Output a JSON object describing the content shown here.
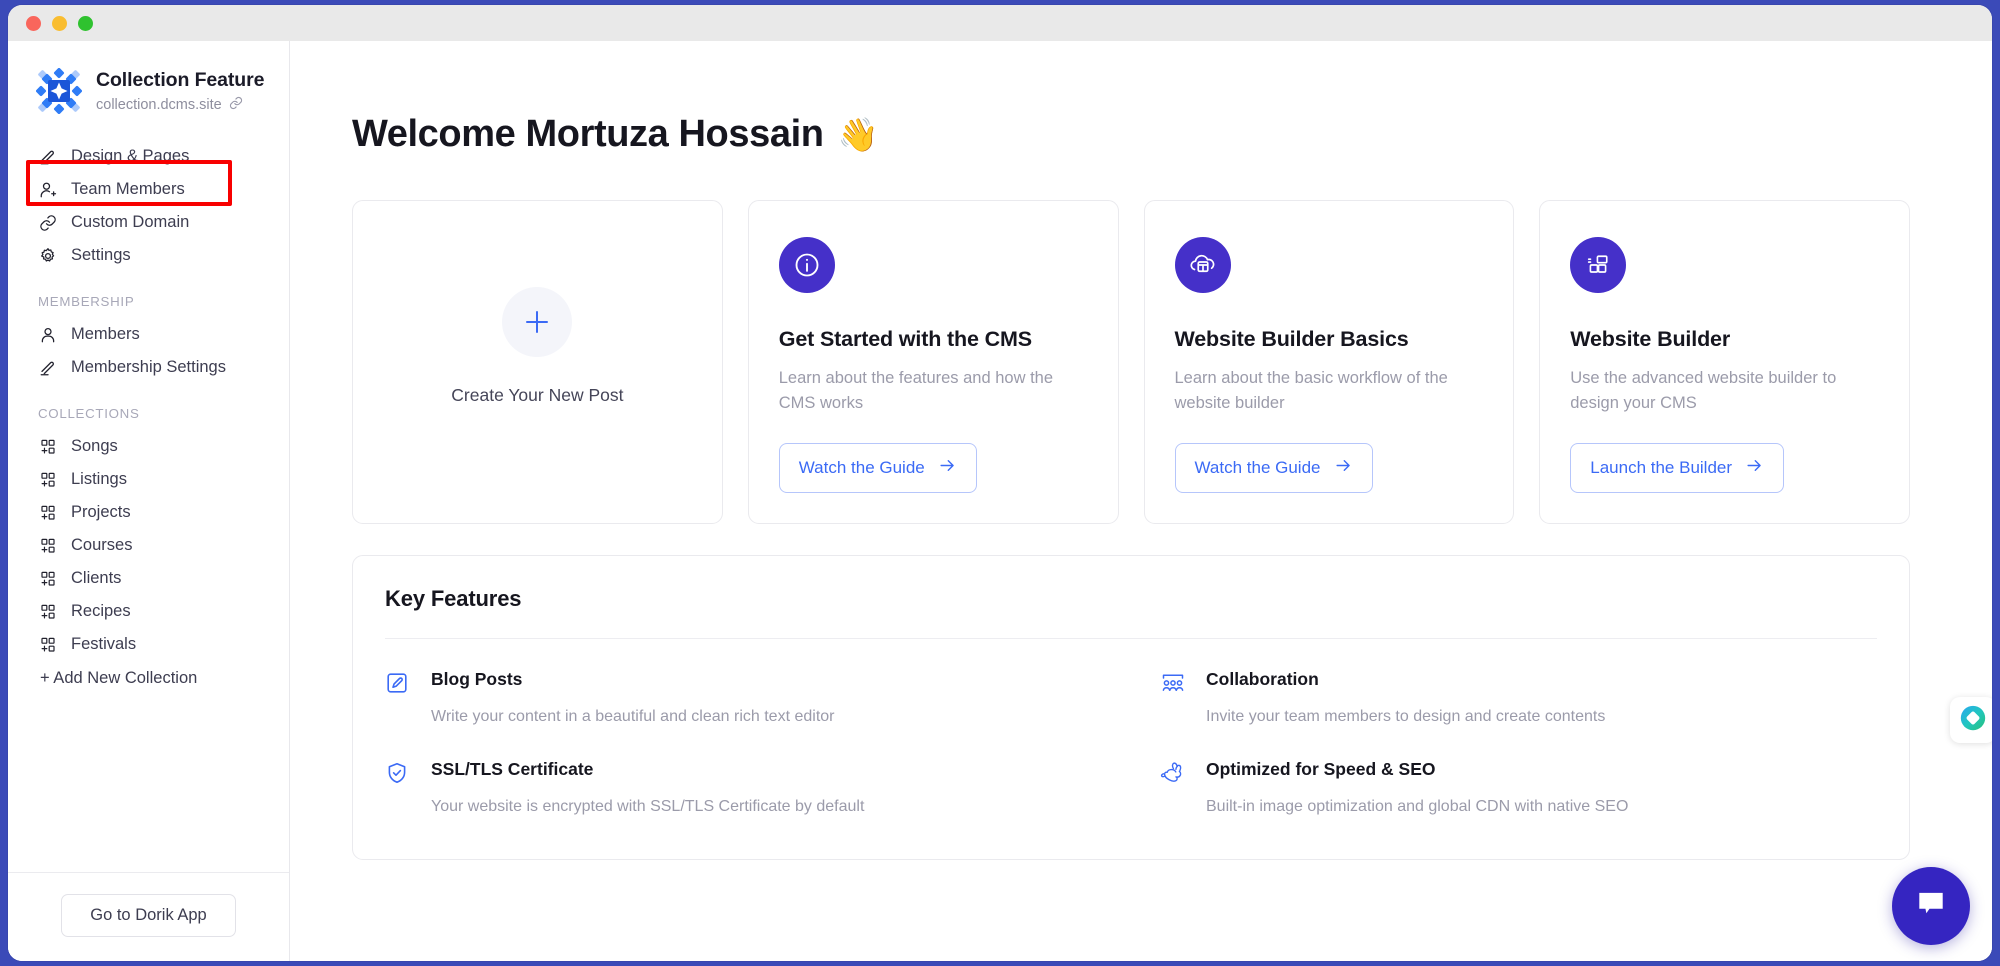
{
  "window": {
    "traffic_lights": [
      "close",
      "minimize",
      "maximize"
    ]
  },
  "sidebar": {
    "brand": {
      "title": "Collection Feature",
      "domain": "collection.dcms.site",
      "link_icon": "link-icon",
      "logo_icon": "dorik-logo-icon"
    },
    "main_nav": [
      {
        "label": "Design & Pages",
        "icon": "pencil-icon",
        "highlighted": true
      },
      {
        "label": "Team Members",
        "icon": "user-add-icon"
      },
      {
        "label": "Custom Domain",
        "icon": "link-icon"
      },
      {
        "label": "Settings",
        "icon": "gear-icon"
      }
    ],
    "membership_label": "MEMBERSHIP",
    "membership_nav": [
      {
        "label": "Members",
        "icon": "user-icon"
      },
      {
        "label": "Membership Settings",
        "icon": "pencil-icon"
      }
    ],
    "collections_label": "COLLECTIONS",
    "collections": [
      {
        "label": "Songs",
        "icon": "collection-grid-icon"
      },
      {
        "label": "Listings",
        "icon": "collection-grid-icon"
      },
      {
        "label": "Projects",
        "icon": "collection-grid-icon"
      },
      {
        "label": "Courses",
        "icon": "collection-grid-icon"
      },
      {
        "label": "Clients",
        "icon": "collection-grid-icon"
      },
      {
        "label": "Recipes",
        "icon": "collection-grid-icon"
      },
      {
        "label": "Festivals",
        "icon": "collection-grid-icon"
      }
    ],
    "add_collection_label": "+ Add New Collection",
    "footer_button": "Go to Dorik App"
  },
  "main": {
    "greeting": "Welcome Mortuza Hossain",
    "greeting_emoji": "👋",
    "create_card": {
      "label": "Create Your New Post",
      "icon": "plus-icon"
    },
    "cards": [
      {
        "icon": "info-circle-icon",
        "title": "Get Started with the CMS",
        "description": "Learn about the features and how the CMS works",
        "button": "Watch the Guide",
        "button_icon": "arrow-right-icon"
      },
      {
        "icon": "cloud-browser-icon",
        "title": "Website Builder Basics",
        "description": "Learn about the basic workflow of the website builder",
        "button": "Watch the Guide",
        "button_icon": "arrow-right-icon"
      },
      {
        "icon": "layout-blocks-icon",
        "title": "Website Builder",
        "description": "Use the advanced website builder to design your CMS",
        "button": "Launch the Builder",
        "button_icon": "arrow-right-icon"
      }
    ],
    "features": {
      "title": "Key Features",
      "items": [
        {
          "icon": "edit-square-icon",
          "name": "Blog Posts",
          "description": "Write your content in a beautiful and clean rich text editor"
        },
        {
          "icon": "people-group-icon",
          "name": "Collaboration",
          "description": "Invite your team members to design and create contents"
        },
        {
          "icon": "shield-check-icon",
          "name": "SSL/TLS Certificate",
          "description": "Your website is encrypted with SSL/TLS Certificate by default"
        },
        {
          "icon": "rabbit-icon",
          "name": "Optimized for Speed & SEO",
          "description": "Built-in image optimization and global CDN with native SEO"
        }
      ]
    }
  },
  "widgets": {
    "badge_icon": "diamond-gradient-icon",
    "chat_icon": "chat-bubble-icon"
  },
  "colors": {
    "accent_purple": "#4530c9",
    "link_blue": "#3b6af5",
    "annotation_red": "#f80000",
    "frame_blue": "#3b4ab8"
  }
}
